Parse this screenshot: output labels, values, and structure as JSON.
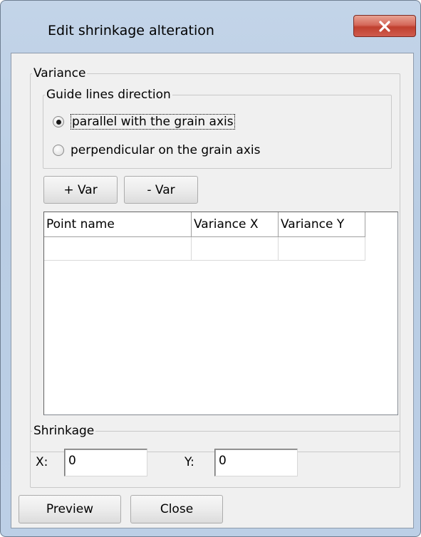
{
  "window": {
    "title": "Edit shrinkage alteration",
    "close_icon": "x-icon"
  },
  "variance": {
    "group_label": "Variance",
    "guide": {
      "group_label": "Guide lines direction",
      "options": [
        {
          "label": "parallel with the grain axis",
          "selected": true
        },
        {
          "label": "perpendicular on the grain axis",
          "selected": false
        }
      ]
    },
    "add_var_label": "+ Var",
    "remove_var_label": "- Var",
    "table": {
      "columns": [
        "Point name",
        "Variance X",
        "Variance Y"
      ],
      "rows": [
        [
          "",
          "",
          ""
        ]
      ]
    }
  },
  "shrinkage": {
    "group_label": "Shrinkage",
    "x_label": "X:",
    "x_value": "0",
    "y_label": "Y:",
    "y_value": "0"
  },
  "buttons": {
    "preview_label": "Preview",
    "close_label": "Close"
  }
}
